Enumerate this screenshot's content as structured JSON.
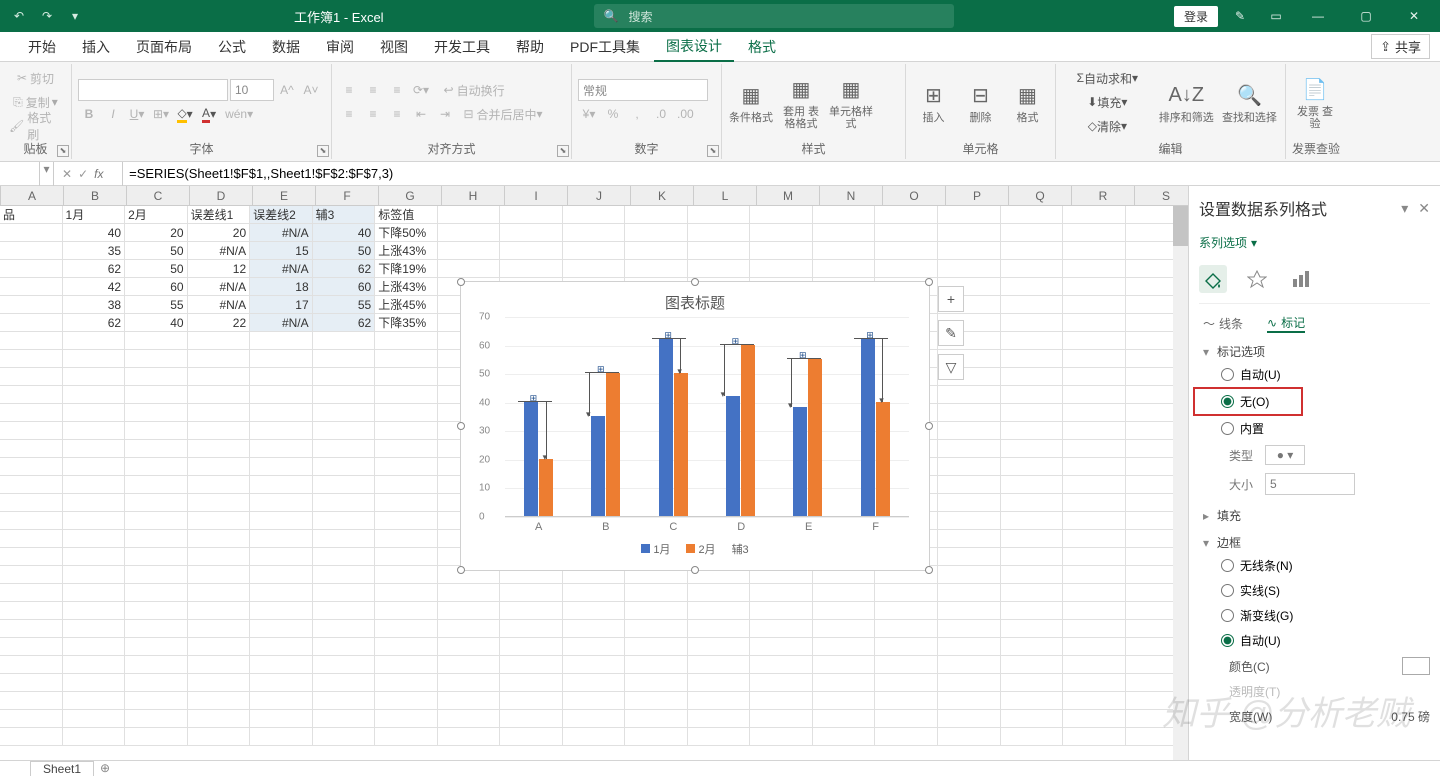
{
  "titlebar": {
    "title": "工作簿1 - Excel",
    "search_placeholder": "搜索",
    "login": "登录"
  },
  "ribbon_tabs": [
    "开始",
    "插入",
    "页面布局",
    "公式",
    "数据",
    "审阅",
    "视图",
    "开发工具",
    "帮助",
    "PDF工具集",
    "图表设计",
    "格式"
  ],
  "active_tab": "图表设计",
  "share": "共享",
  "clipboard": {
    "cut": "剪切",
    "copy": "复制",
    "paint": "格式刷",
    "label": "贴板"
  },
  "font_group": {
    "font": "",
    "size": "10",
    "label": "字体"
  },
  "align_group": {
    "wrap": "自动换行",
    "merge": "合并后居中",
    "label": "对齐方式"
  },
  "number_group": {
    "format": "常规",
    "label": "数字"
  },
  "styles_group": {
    "cond": "条件格式",
    "table": "套用\n表格格式",
    "cell": "单元格样式",
    "label": "样式"
  },
  "cells_group": {
    "insert": "插入",
    "delete": "删除",
    "format": "格式",
    "label": "单元格"
  },
  "edit_group": {
    "sum": "自动求和",
    "fill": "填充",
    "clear": "清除",
    "sort": "排序和筛选",
    "find": "查找和选择",
    "label": "编辑"
  },
  "invoice_group": {
    "btn": "发票\n查验",
    "label": "发票查验"
  },
  "formula_bar": {
    "value": "=SERIES(Sheet1!$F$1,,Sheet1!$F$2:$F$7,3)"
  },
  "columns": [
    "A",
    "B",
    "C",
    "D",
    "E",
    "F",
    "G",
    "H",
    "I",
    "J",
    "K",
    "L",
    "M",
    "N",
    "O",
    "P",
    "Q",
    "R",
    "S"
  ],
  "grid": {
    "headers": [
      "品",
      "1月",
      "2月",
      "误差线1",
      "误差线2",
      "辅3",
      "标签值"
    ],
    "rows": [
      [
        "",
        "40",
        "20",
        "20",
        "#N/A",
        "40",
        "下降50%"
      ],
      [
        "",
        "35",
        "50",
        "#N/A",
        "15",
        "50",
        "上涨43%"
      ],
      [
        "",
        "62",
        "50",
        "12",
        "#N/A",
        "62",
        "下降19%"
      ],
      [
        "",
        "42",
        "60",
        "#N/A",
        "18",
        "60",
        "上涨43%"
      ],
      [
        "",
        "38",
        "55",
        "#N/A",
        "17",
        "55",
        "上涨45%"
      ],
      [
        "",
        "62",
        "40",
        "22",
        "#N/A",
        "62",
        "下降35%"
      ]
    ]
  },
  "chart_data": {
    "type": "bar",
    "title": "图表标题",
    "categories": [
      "A",
      "B",
      "C",
      "D",
      "E",
      "F"
    ],
    "series": [
      {
        "name": "1月",
        "color": "#4472c4",
        "values": [
          40,
          35,
          62,
          42,
          38,
          62
        ]
      },
      {
        "name": "2月",
        "color": "#ed7d31",
        "values": [
          20,
          50,
          50,
          60,
          55,
          40
        ]
      },
      {
        "name": "辅3",
        "color": "#a5a5a5",
        "values": [
          40,
          50,
          62,
          60,
          55,
          62
        ]
      }
    ],
    "ylabel": "",
    "xlabel": "",
    "ylim": [
      0,
      70
    ],
    "yticks": [
      0,
      10,
      20,
      30,
      40,
      50,
      60,
      70
    ]
  },
  "pane": {
    "title": "设置数据系列格式",
    "series_opt": "系列选项",
    "tab_line": "线条",
    "tab_marker": "标记",
    "section_marker_opts": "标记选项",
    "opt_auto": "自动(U)",
    "opt_none": "无(O)",
    "opt_builtin": "内置",
    "field_type": "类型",
    "field_size": "大小",
    "size_value": "5",
    "section_fill": "填充",
    "section_border": "边框",
    "border_none": "无线条(N)",
    "border_solid": "实线(S)",
    "border_grad": "渐变线(G)",
    "border_auto": "自动(U)",
    "color_label": "颜色(C)",
    "trans_label": "透明度(T)",
    "width_label": "宽度(W)",
    "width_value": "0.75 磅"
  },
  "sheet_tab": "Sheet1",
  "watermark": "知乎 @分析老贼"
}
